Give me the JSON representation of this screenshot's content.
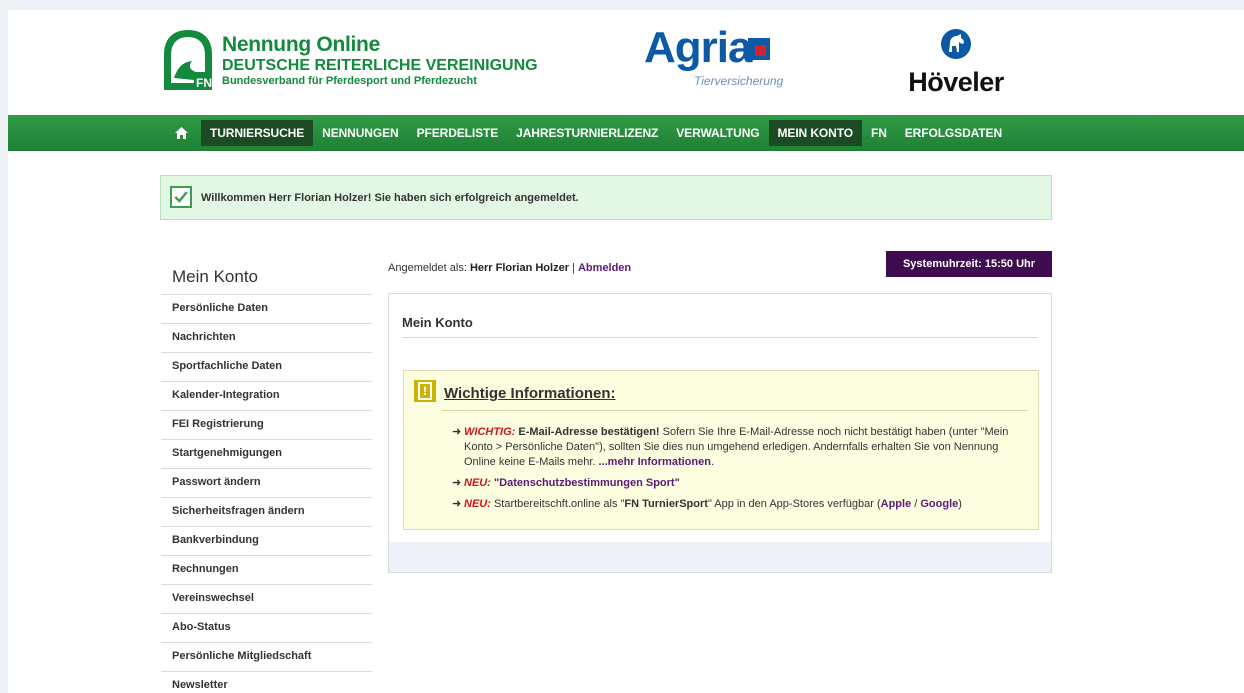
{
  "header": {
    "fn_logo_text": "FN",
    "fn_title": "Nennung Online",
    "fn_subtitle": "DEUTSCHE REITERLICHE VEREINIGUNG",
    "fn_subsubtitle": "Bundesverband für Pferdesport und Pferdezucht",
    "agria_word": "Agria",
    "agria_tagline": "Tierversicherung",
    "hoeveler_word": "Höveler"
  },
  "nav": {
    "items": [
      {
        "label": "TURNIERSUCHE",
        "active": true
      },
      {
        "label": "NENNUNGEN",
        "active": false
      },
      {
        "label": "PFERDELISTE",
        "active": false
      },
      {
        "label": "JAHRESTURNIERLIZENZ",
        "active": false
      },
      {
        "label": "VERWALTUNG",
        "active": false
      },
      {
        "label": "MEIN KONTO",
        "active": true
      },
      {
        "label": "FN",
        "active": false
      },
      {
        "label": "ERFOLGSDATEN",
        "active": false
      }
    ]
  },
  "welcome": {
    "text": "Willkommen Herr Florian Holzer! Sie haben sich erfolgreich angemeldet."
  },
  "sidebar": {
    "title": "Mein Konto",
    "items": [
      "Persönliche Daten",
      "Nachrichten",
      "Sportfachliche Daten",
      "Kalender-Integration",
      "FEI Registrierung",
      "Startgenehmigungen",
      "Passwort ändern",
      "Sicherheitsfragen ändern",
      "Bankverbindung",
      "Rechnungen",
      "Vereinswechsel",
      "Abo-Status",
      "Persönliche Mitgliedschaft",
      "Newsletter"
    ]
  },
  "status": {
    "logged_in_prefix": "Angemeldet als:",
    "user_name": "Herr Florian Holzer",
    "separator": "|",
    "logout": "Abmelden",
    "clock": "Systemuhrzeit: 15:50 Uhr"
  },
  "panel": {
    "title": "Mein Konto",
    "info_icon": "!",
    "info_title": "Wichtige Informationen:",
    "b1_label": "WICHTIG:",
    "b1_bold": "E-Mail-Adresse bestätigen!",
    "b1_text": " Sofern Sie Ihre E-Mail-Adresse noch nicht bestätigt haben (unter \"Mein Konto > Persönliche Daten\"), sollten Sie dies nun umgehend erledigen. Andernfalls erhalten Sie von Nennung Online keine E-Mails mehr. ",
    "b1_link": "...mehr Informationen",
    "b1_end": ".",
    "b2_label": "NEU:",
    "b2_link": "\"Datenschutzbestimmungen Sport\"",
    "b3_label": "NEU:",
    "b3_text1": " Startbereitschft.online als \"",
    "b3_bold": "FN TurnierSport",
    "b3_text2": "\" App in den App-Stores verfügbar (",
    "b3_link1": "Apple",
    "b3_sep": " / ",
    "b3_link2": "Google",
    "b3_end": ")"
  },
  "colors": {
    "nav_green": "#2f9b45",
    "nav_active": "#1b4a25",
    "clock_bg": "#3f0c52",
    "link_purple": "#5a1a7a",
    "alert_red": "#d0141c"
  }
}
